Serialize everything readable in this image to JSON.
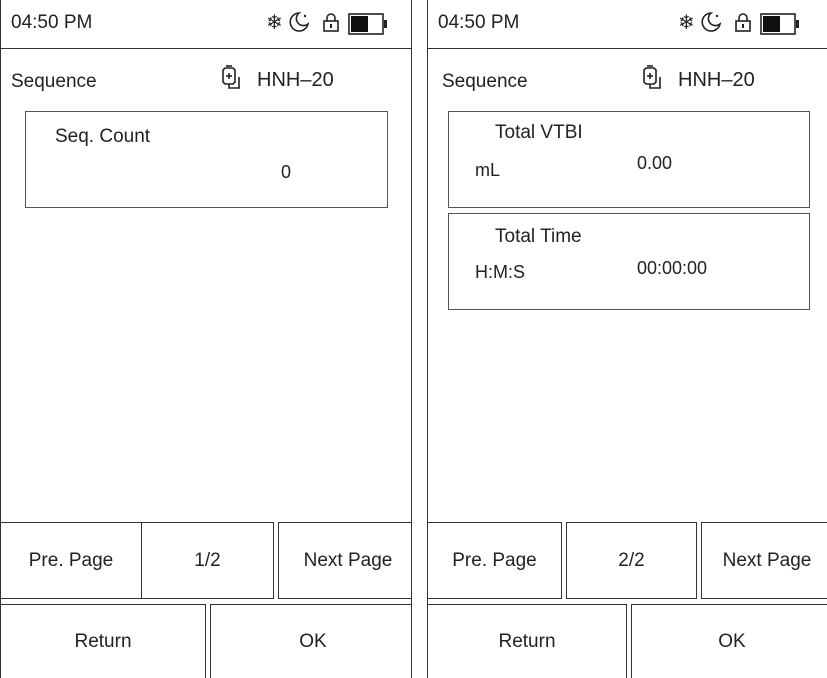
{
  "screens": [
    {
      "status": {
        "time": "04:50 PM",
        "icons": [
          "snowflake-icon",
          "night-mode-icon",
          "lock-icon",
          "battery-icon"
        ]
      },
      "header": {
        "title": "Sequence",
        "device_icon": "infusion-bag-icon",
        "device": "HNH–20"
      },
      "fields": {
        "seq_count": {
          "label": "Seq. Count",
          "value": "0"
        }
      },
      "nav": {
        "prev": "Pre. Page",
        "page": "1/2",
        "next": "Next Page"
      },
      "actions": {
        "return": "Return",
        "ok": "OK"
      }
    },
    {
      "status": {
        "time": "04:50 PM",
        "icons": [
          "snowflake-icon",
          "night-mode-icon",
          "lock-icon",
          "battery-icon"
        ]
      },
      "header": {
        "title": "Sequence",
        "device_icon": "infusion-bag-icon",
        "device": "HNH–20"
      },
      "fields": {
        "total_vtbi": {
          "label": "Total VTBI",
          "unit": "mL",
          "value": "0.00"
        },
        "total_time": {
          "label": "Total Time",
          "unit": "H:M:S",
          "value": "00:00:00"
        }
      },
      "nav": {
        "prev": "Pre. Page",
        "page": "2/2",
        "next": "Next Page"
      },
      "actions": {
        "return": "Return",
        "ok": "OK"
      }
    }
  ],
  "battery_level": 0.55
}
